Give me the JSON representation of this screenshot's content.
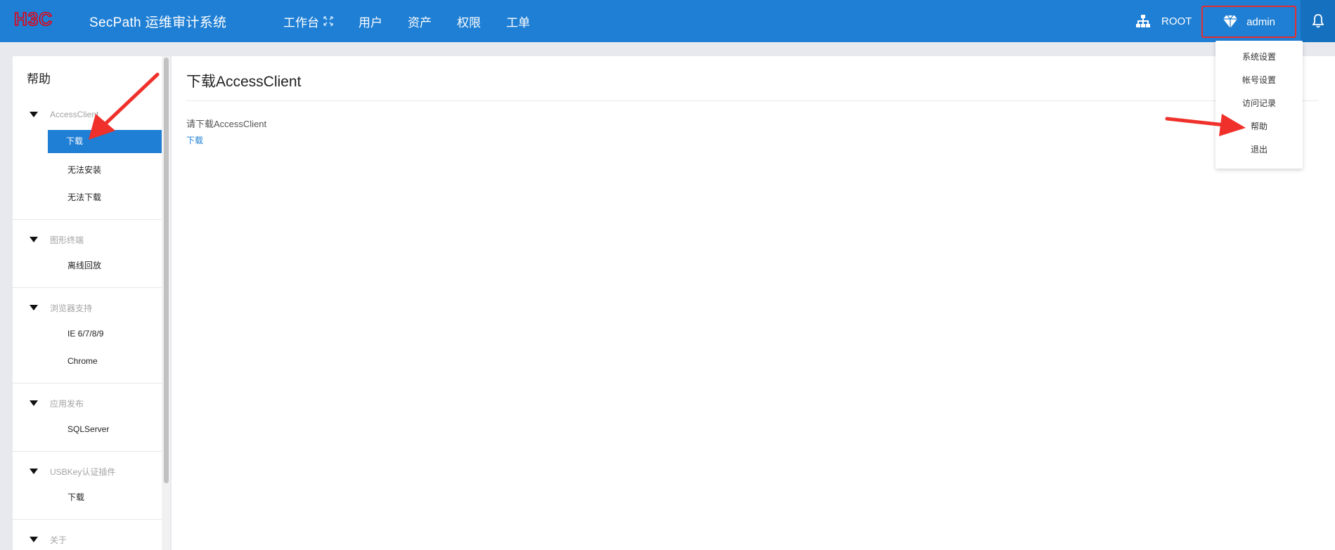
{
  "header": {
    "brand": "H3C",
    "app_title": "SecPath 运维审计系统",
    "nav": [
      "工作台",
      "用户",
      "资产",
      "权限",
      "工单"
    ],
    "org_label": "ROOT",
    "username": "admin",
    "brand_color": "#1f7fd4",
    "logo_color": "#e60012"
  },
  "user_menu": {
    "items": [
      "系统设置",
      "帐号设置",
      "访问记录",
      "帮助",
      "退出"
    ]
  },
  "sidebar": {
    "title": "帮助",
    "sections": [
      {
        "title": "AccessClient",
        "items": [
          "下载",
          "无法安装",
          "无法下载"
        ]
      },
      {
        "title": "图形终端",
        "items": [
          "离线回放"
        ]
      },
      {
        "title": "浏览器支持",
        "items": [
          "IE 6/7/8/9",
          "Chrome"
        ]
      },
      {
        "title": "应用发布",
        "items": [
          "SQLServer"
        ]
      },
      {
        "title": "USBKey认证插件",
        "items": [
          "下载"
        ]
      },
      {
        "title": "关于",
        "items": []
      }
    ],
    "active_item": "下载"
  },
  "main": {
    "title": "下载AccessClient",
    "description": "请下载AccessClient",
    "link": "下载"
  },
  "annotation_color": "#f0302a"
}
